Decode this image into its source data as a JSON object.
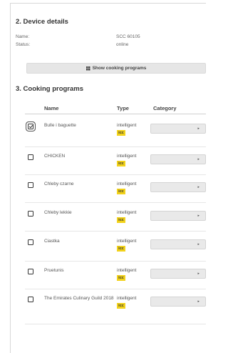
{
  "device": {
    "title": "2. Device details",
    "name_label": "Name:",
    "name_value": "SCC 60105",
    "status_label": "Status:",
    "status_value": "online"
  },
  "show_button": {
    "label": "Show cooking programs",
    "icon": "grid-icon"
  },
  "programs": {
    "title": "3. Cooking programs",
    "columns": {
      "name": "Name",
      "type": "Type",
      "category": "Category"
    },
    "rows": [
      {
        "checked": true,
        "name": "Bulle i baguette",
        "type": "intelligent",
        "badge": "icc",
        "category": ""
      },
      {
        "checked": false,
        "name": "CHICKEN",
        "type": "intelligent",
        "badge": "icc",
        "category": ""
      },
      {
        "checked": false,
        "name": "Chleby czarne",
        "type": "intelligent",
        "badge": "icc",
        "category": ""
      },
      {
        "checked": false,
        "name": "Chleby lekkie",
        "type": "intelligent",
        "badge": "icc",
        "category": ""
      },
      {
        "checked": false,
        "name": "Ciastka",
        "type": "intelligent",
        "badge": "icc",
        "category": ""
      },
      {
        "checked": false,
        "name": "Pruetunis",
        "type": "intelligent",
        "badge": "icc",
        "category": ""
      },
      {
        "checked": false,
        "name": "The Emirates Culinary Guild 2018",
        "type": "intelligent",
        "badge": "icc",
        "category": ""
      }
    ]
  },
  "colors": {
    "badge": "#f2d21a",
    "select_bg": "#e9e9e9",
    "button_bg": "#e6e6e6"
  }
}
